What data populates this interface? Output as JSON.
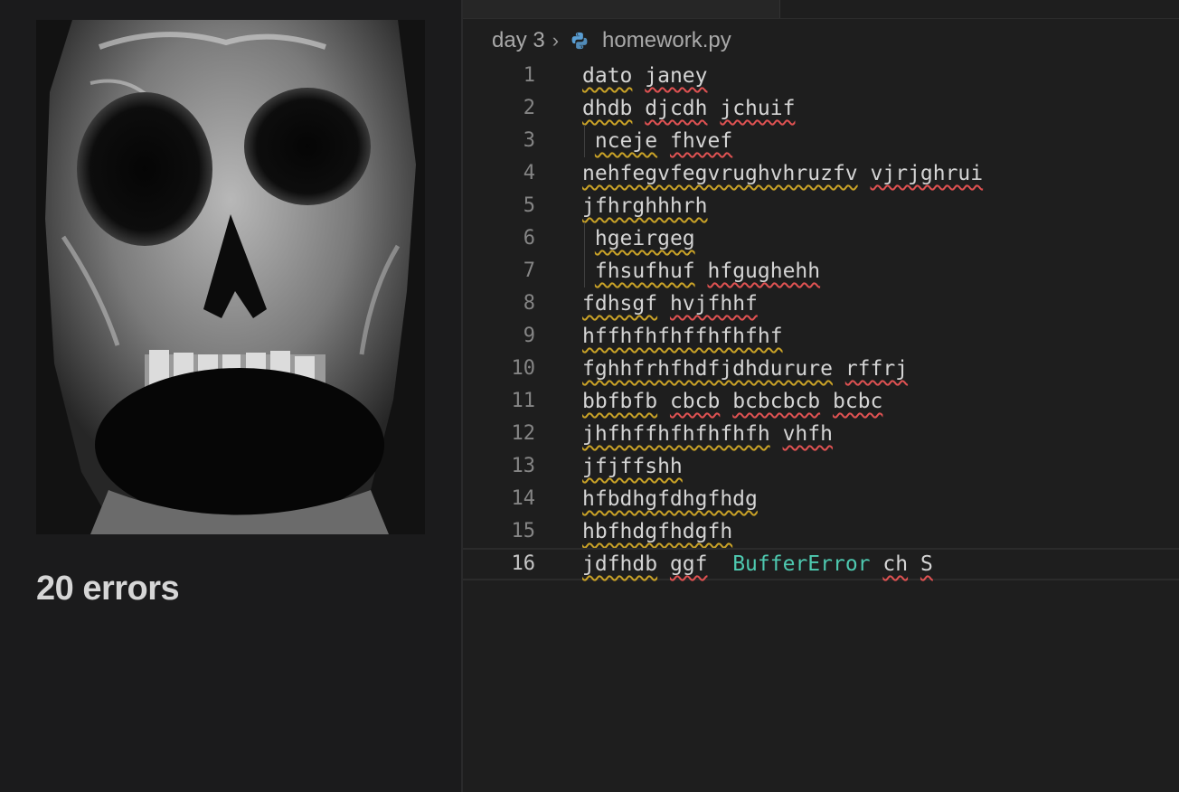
{
  "meme": {
    "caption": "20 errors"
  },
  "editor": {
    "breadcrumb": {
      "folder": "day 3",
      "separator": "›",
      "file": "homework.py",
      "file_icon": "python-icon"
    },
    "current_line": 16,
    "lines": [
      {
        "n": "1",
        "indent": false,
        "tokens": [
          {
            "t": "dato",
            "s": "warn"
          },
          {
            "t": " "
          },
          {
            "t": "janey",
            "s": "err"
          }
        ]
      },
      {
        "n": "2",
        "indent": false,
        "tokens": [
          {
            "t": "dhdb",
            "s": "warn"
          },
          {
            "t": " "
          },
          {
            "t": "djcdh",
            "s": "err"
          },
          {
            "t": " "
          },
          {
            "t": "jchuif",
            "s": "err"
          }
        ]
      },
      {
        "n": "3",
        "indent": true,
        "tokens": [
          {
            "t": " "
          },
          {
            "t": "nceje",
            "s": "warn"
          },
          {
            "t": " "
          },
          {
            "t": "fhvef",
            "s": "err"
          }
        ]
      },
      {
        "n": "4",
        "indent": false,
        "tokens": [
          {
            "t": "nehfegvfegvrughvhruzfv",
            "s": "warn"
          },
          {
            "t": " "
          },
          {
            "t": "vjrjghrui",
            "s": "err"
          }
        ]
      },
      {
        "n": "5",
        "indent": false,
        "tokens": [
          {
            "t": "jfhrghhhrh",
            "s": "warn"
          }
        ]
      },
      {
        "n": "6",
        "indent": true,
        "tokens": [
          {
            "t": " "
          },
          {
            "t": "hgeirgeg",
            "s": "warn"
          }
        ]
      },
      {
        "n": "7",
        "indent": true,
        "tokens": [
          {
            "t": " "
          },
          {
            "t": "fhsufhuf",
            "s": "warn"
          },
          {
            "t": " "
          },
          {
            "t": "hfgughehh",
            "s": "err"
          }
        ]
      },
      {
        "n": "8",
        "indent": false,
        "tokens": [
          {
            "t": "fdhsgf",
            "s": "warn"
          },
          {
            "t": " "
          },
          {
            "t": "hvjfhhf",
            "s": "err"
          }
        ]
      },
      {
        "n": "9",
        "indent": false,
        "tokens": [
          {
            "t": "hffhfhfhffhfhfhf",
            "s": "warn"
          }
        ]
      },
      {
        "n": "10",
        "indent": false,
        "tokens": [
          {
            "t": "fghhfrhfhdfjdhdurure",
            "s": "warn"
          },
          {
            "t": " "
          },
          {
            "t": "rffrj",
            "s": "err"
          }
        ]
      },
      {
        "n": "11",
        "indent": false,
        "tokens": [
          {
            "t": "bbfbfb",
            "s": "warn"
          },
          {
            "t": " "
          },
          {
            "t": "cbcb",
            "s": "err"
          },
          {
            "t": " "
          },
          {
            "t": "bcbcbcb",
            "s": "err"
          },
          {
            "t": " "
          },
          {
            "t": "bcbc",
            "s": "err"
          }
        ]
      },
      {
        "n": "12",
        "indent": false,
        "tokens": [
          {
            "t": "jhfhffhfhfhfhfh",
            "s": "warn"
          },
          {
            "t": " "
          },
          {
            "t": "vhfh",
            "s": "err"
          }
        ]
      },
      {
        "n": "13",
        "indent": false,
        "tokens": [
          {
            "t": "jfjffshh",
            "s": "warn"
          }
        ]
      },
      {
        "n": "14",
        "indent": false,
        "tokens": [
          {
            "t": "hfbdhgfdhgfhdg",
            "s": "warn"
          }
        ]
      },
      {
        "n": "15",
        "indent": false,
        "tokens": [
          {
            "t": "hbfhdgfhdgfh",
            "s": "warn"
          }
        ]
      },
      {
        "n": "16",
        "indent": false,
        "tokens": [
          {
            "t": "jdfhdb",
            "s": "warn"
          },
          {
            "t": " "
          },
          {
            "t": "ggf",
            "s": "err"
          },
          {
            "t": "  "
          },
          {
            "t": "BufferError",
            "s": "builtin"
          },
          {
            "t": " "
          },
          {
            "t": "ch",
            "s": "err"
          },
          {
            "t": " "
          },
          {
            "t": "S",
            "s": "err"
          }
        ]
      }
    ]
  },
  "colors": {
    "warning_squiggle": "#c9a227",
    "error_squiggle": "#e05252",
    "builtin_name": "#4ec9b0",
    "python_icon": "#5a9fd4"
  }
}
